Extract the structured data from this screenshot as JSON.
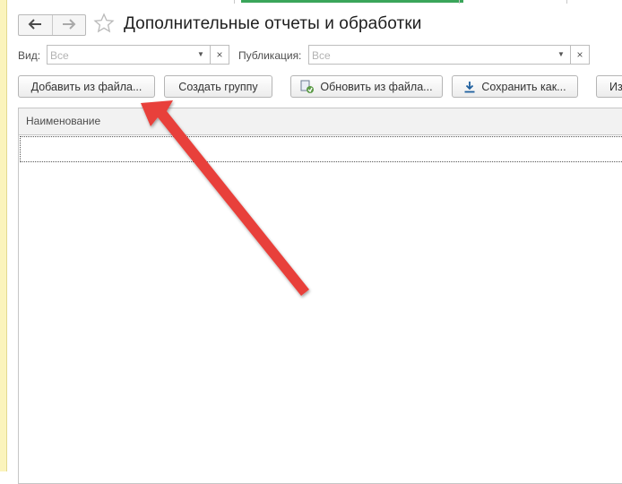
{
  "header": {
    "title": "Дополнительные отчеты и обработки",
    "back_icon": "arrow-left-icon",
    "forward_icon": "arrow-right-icon",
    "favorite_icon": "star-icon"
  },
  "filters": {
    "kind_label": "Вид:",
    "kind_placeholder": "Все",
    "publication_label": "Публикация:",
    "publication_placeholder": "Все"
  },
  "toolbar": {
    "add_from_file": "Добавить из файла...",
    "create_group": "Создать группу",
    "update_from_file": "Обновить из файла...",
    "save_as": "Сохранить как...",
    "partial_button": "Из"
  },
  "table": {
    "columns": [
      "Наименование"
    ]
  },
  "colors": {
    "accent": "#3aa55a",
    "arrow": "#e8403a",
    "sidebar": "#fbf4bc"
  }
}
